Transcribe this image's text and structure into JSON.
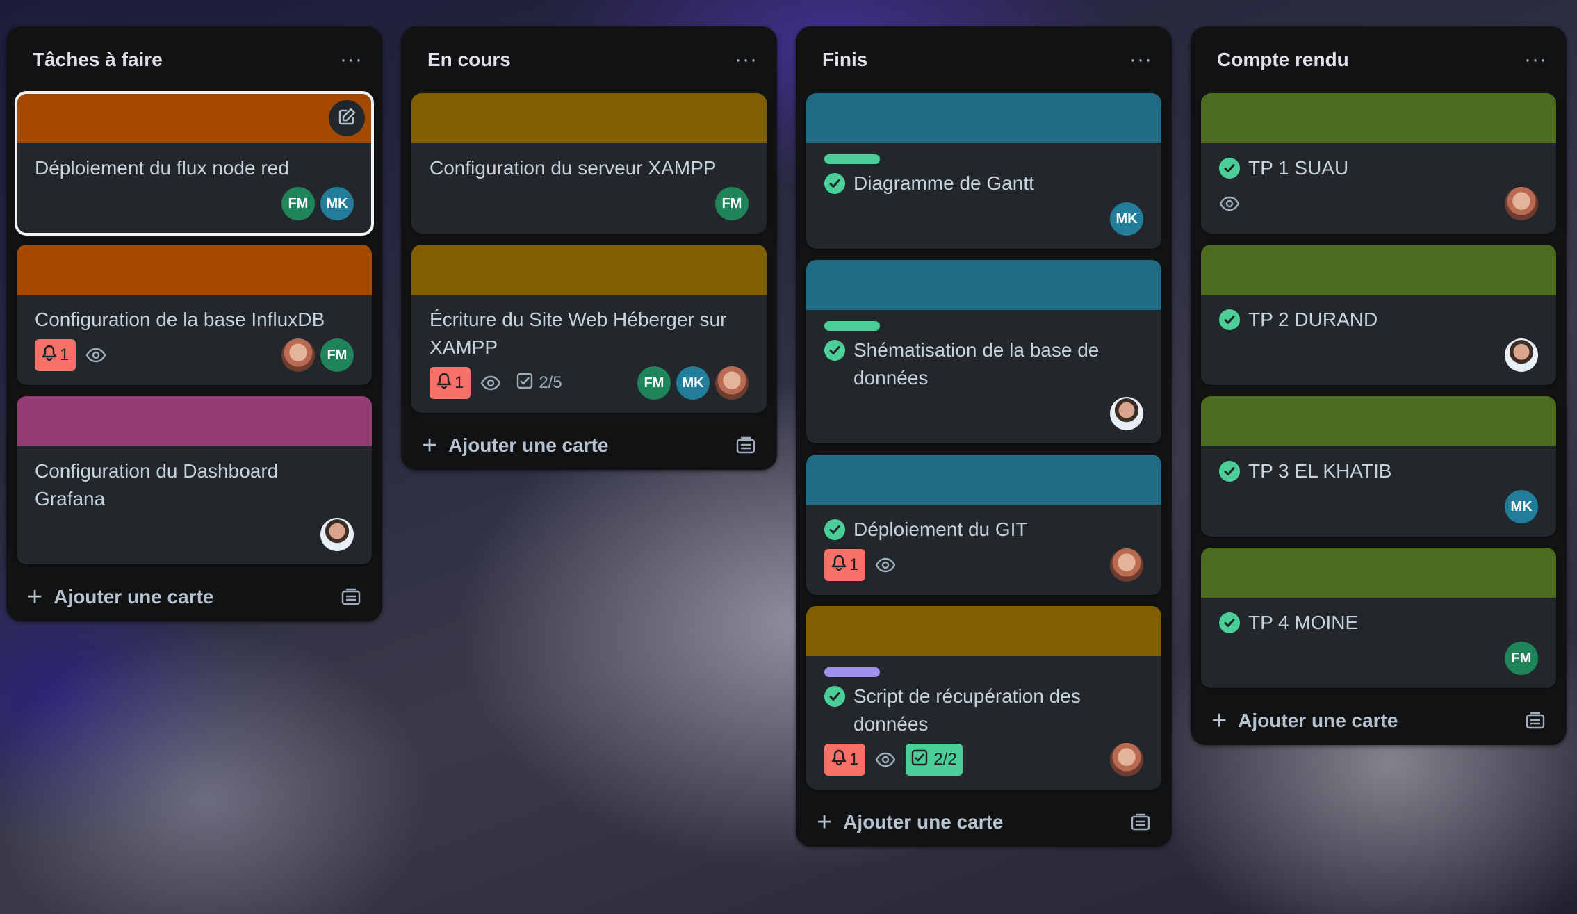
{
  "colors": {
    "orange": "#a54800",
    "olive": "#7f5f01",
    "teal": "#206a83",
    "green": "#4c6b1f",
    "magenta": "#943d73",
    "label_green": "#4bce97",
    "label_purple": "#9f8fef"
  },
  "common": {
    "add_card": "Ajouter une carte",
    "menu": "···"
  },
  "lists": [
    {
      "title": "Tâches à faire",
      "cards": [
        {
          "title": "Déploiement du flux node red",
          "cover": "orange",
          "members": [
            "FM",
            "MK"
          ],
          "selected": true
        },
        {
          "title": "Configuration de la base InfluxDB",
          "cover": "orange",
          "due": "1",
          "watch": true,
          "members": [
            "photo",
            "FM"
          ]
        },
        {
          "title": "Configuration du Dashboard Grafana",
          "cover": "magenta",
          "members": [
            "photo2"
          ]
        }
      ]
    },
    {
      "title": "En cours",
      "cards": [
        {
          "title": "Configuration du serveur XAMPP",
          "cover": "olive",
          "members": [
            "FM"
          ]
        },
        {
          "title": "Écriture du Site Web Héberger sur XAMPP",
          "cover": "olive",
          "due": "1",
          "watch": true,
          "checklist": "2/5",
          "members": [
            "FM",
            "MK",
            "photo"
          ]
        }
      ]
    },
    {
      "title": "Finis",
      "cards": [
        {
          "title": "Diagramme de Gantt",
          "cover": "teal",
          "label": "green",
          "done": true,
          "members": [
            "MK"
          ]
        },
        {
          "title": "Shématisation de la base de données",
          "cover": "teal",
          "label": "green",
          "done": true,
          "members": [
            "photo2"
          ]
        },
        {
          "title": "Déploiement du GIT",
          "cover": "teal",
          "done": true,
          "due": "1",
          "watch": true,
          "members": [
            "photo"
          ]
        },
        {
          "title": "Script de récupération des données",
          "cover": "olive",
          "label": "purple",
          "done": true,
          "due": "1",
          "watch": true,
          "checklist": "2/2",
          "checklist_done": true,
          "members": [
            "photo"
          ]
        }
      ]
    },
    {
      "title": "Compte rendu",
      "cards": [
        {
          "title": "TP 1 SUAU",
          "cover": "green",
          "done": true,
          "watch": true,
          "members": [
            "photo"
          ]
        },
        {
          "title": "TP 2 DURAND",
          "cover": "green",
          "done": true,
          "members": [
            "photo2"
          ]
        },
        {
          "title": "TP 3 EL KHATIB",
          "cover": "green",
          "done": true,
          "members": [
            "MK"
          ]
        },
        {
          "title": "TP 4 MOINE",
          "cover": "green",
          "done": true,
          "members": [
            "FM"
          ]
        }
      ]
    }
  ]
}
